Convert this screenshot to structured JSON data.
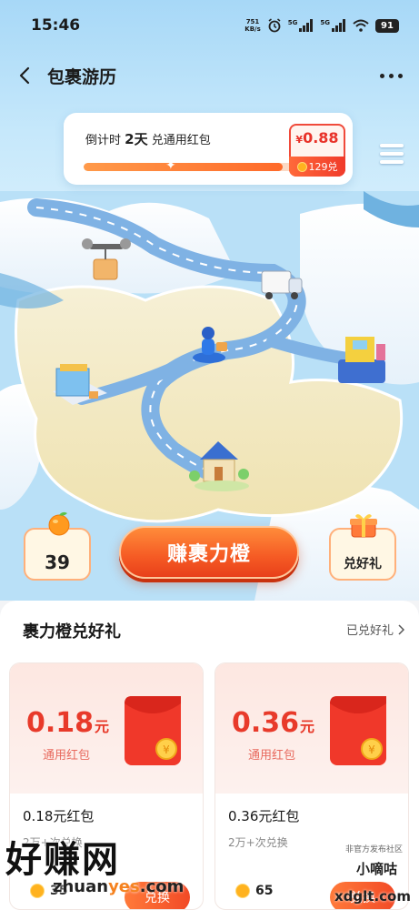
{
  "status_bar": {
    "time": "15:46",
    "net_speed_value": "751",
    "net_speed_unit": "KB/s",
    "signal_1_label": "5G",
    "signal_2_label": "5G",
    "battery": "91"
  },
  "header": {
    "title": "包裹游历"
  },
  "countdown": {
    "prefix": "倒计时",
    "days": "2天",
    "suffix": "兑通用红包",
    "reward_symbol": "¥",
    "reward_amount": "0.88",
    "reward_cost": "129兑",
    "progress_fraction": 0.95
  },
  "controls": {
    "orange_count": "39",
    "earn_button": "赚裹力橙",
    "gift_label": "兑好礼"
  },
  "panel": {
    "title": "裹力橙兑好礼",
    "redeemed_link": "已兑好礼",
    "prizes": [
      {
        "amount": "0.18",
        "unit": "元",
        "type": "通用红包",
        "name": "0.18元红包",
        "count": "2万+次兑换",
        "cost": "35",
        "button": "兑换"
      },
      {
        "amount": "0.36",
        "unit": "元",
        "type": "通用红包",
        "name": "0.36元红包",
        "count": "2万+次兑换",
        "cost": "65",
        "button": "兑换"
      }
    ]
  },
  "watermarks": {
    "main": "好赚网",
    "url_prefix": "zhuan",
    "url_highlight": "yes",
    "url_suffix": ".com",
    "right_small": "非官方发布社区",
    "right": "小嘀咕",
    "right_url": "xdglt.com"
  },
  "colors": {
    "accent_orange": "#f55a24",
    "price_red": "#e83a2a",
    "road_blue": "#7fb2e4",
    "map_sea": "#a7d8f7"
  }
}
